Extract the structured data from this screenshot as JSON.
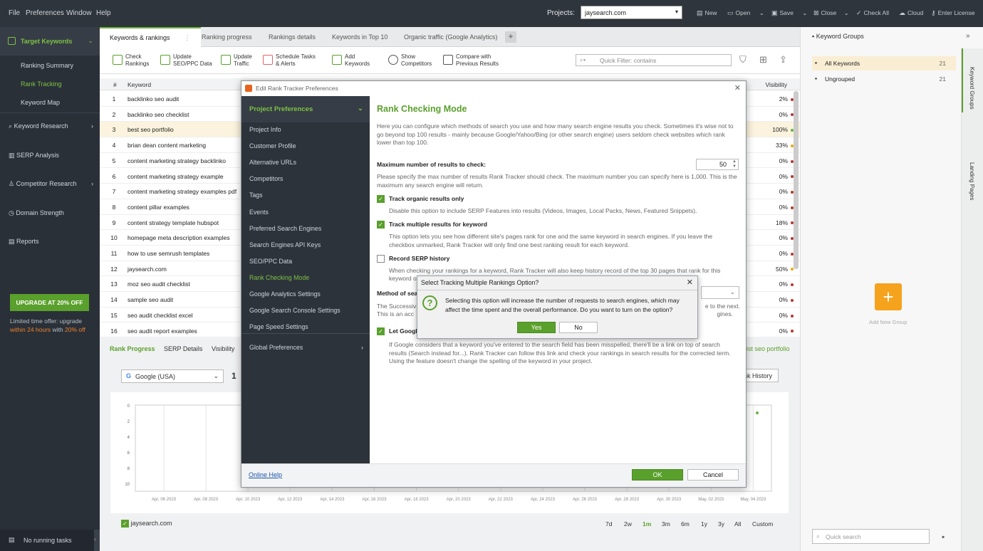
{
  "menu": [
    "File",
    "Preferences",
    "Window",
    "Help"
  ],
  "project": {
    "label": "Projects:",
    "value": "jaysearch.com"
  },
  "toolbar_top": [
    "New",
    "Open",
    "Save",
    "Close",
    "Check All",
    "Cloud",
    "Enter License"
  ],
  "sidebar": {
    "target_keywords": "Target Keywords",
    "sub": [
      "Ranking Summary",
      "Rank Tracking",
      "Keyword Map"
    ],
    "sections": [
      "Keyword Research",
      "SERP Analysis",
      "Competitor Research",
      "Domain Strength",
      "Reports"
    ],
    "upgrade": "UPGRADE AT 20% OFF",
    "offer_1": "Limited time offer: upgrade",
    "offer_2": "within 24 hours",
    "offer_3": "with",
    "offer_4": "20% off",
    "tasks": "No running tasks"
  },
  "tabs": [
    "Keywords & rankings",
    "Ranking progress",
    "Rankings details",
    "Keywords in Top 10",
    "Organic traffic (Google Analytics)"
  ],
  "actions": [
    {
      "l1": "Check",
      "l2": "Rankings"
    },
    {
      "l1": "Update",
      "l2": "SEO/PPC Data"
    },
    {
      "l1": "Update",
      "l2": "Traffic"
    },
    {
      "l1": "Schedule Tasks",
      "l2": "& Alerts"
    },
    {
      "l1": "Add",
      "l2": "Keywords"
    },
    {
      "l1": "Show",
      "l2": "Competitors"
    },
    {
      "l1": "Compare with",
      "l2": "Previous Results"
    }
  ],
  "quick_filter": "Quick Filter: contains",
  "table": {
    "h_num": "#",
    "h_kw": "Keyword",
    "h_vis": "Visibility",
    "rows": [
      {
        "n": "1",
        "k": "backlinko seo audit",
        "v": "2%",
        "c": "r"
      },
      {
        "n": "2",
        "k": "backlinko seo checklist",
        "v": "0%",
        "c": "r"
      },
      {
        "n": "3",
        "k": "best seo portfolio",
        "v": "100%",
        "c": "g"
      },
      {
        "n": "4",
        "k": "brian dean content marketing",
        "v": "33%",
        "c": "y"
      },
      {
        "n": "5",
        "k": "content marketing strategy backlinko",
        "v": "0%",
        "c": "r"
      },
      {
        "n": "6",
        "k": "content marketing strategy example",
        "v": "0%",
        "c": "r"
      },
      {
        "n": "7",
        "k": "content marketing strategy examples pdf",
        "v": "0%",
        "c": "r"
      },
      {
        "n": "8",
        "k": "content pillar examples",
        "v": "0%",
        "c": "r"
      },
      {
        "n": "9",
        "k": "content strategy template hubspot",
        "v": "18%",
        "c": "r"
      },
      {
        "n": "10",
        "k": "homepage meta description examples",
        "v": "0%",
        "c": "r"
      },
      {
        "n": "11",
        "k": "how to use semrush templates",
        "v": "0%",
        "c": "r"
      },
      {
        "n": "12",
        "k": "jaysearch.com",
        "v": "50%",
        "c": "y"
      },
      {
        "n": "13",
        "k": "moz seo audit checklist",
        "v": "0%",
        "c": "r"
      },
      {
        "n": "14",
        "k": "sample seo audit",
        "v": "0%",
        "c": "r"
      },
      {
        "n": "15",
        "k": "seo audit checklist excel",
        "v": "0%",
        "c": "r"
      },
      {
        "n": "16",
        "k": "seo audit report examples",
        "v": "0%",
        "c": "r"
      }
    ]
  },
  "bottom": {
    "tabs": [
      "Rank Progress",
      "SERP Details",
      "Visibility"
    ],
    "engine": "Google (USA)",
    "num": "1",
    "right_link": "est seo portfolio",
    "rank_history": "nk History",
    "y_ticks": [
      "0",
      "2",
      "4",
      "6",
      "8",
      "10"
    ],
    "x_ticks": [
      "Apr, 06 2023",
      "Apr, 08 2023",
      "Apr, 10 2023",
      "Apr, 12 2023",
      "Apr, 14 2023",
      "Apr, 16 2023",
      "Apr, 18 2023",
      "Apr, 20 2023",
      "Apr, 22 2023",
      "Apr, 24 2023",
      "Apr, 26 2023",
      "Apr, 28 2023",
      "Apr, 30 2023",
      "May, 02 2023",
      "May, 04 2023"
    ],
    "legend": "jaysearch.com",
    "ranges": [
      "7d",
      "2w",
      "1m",
      "3m",
      "6m",
      "1y",
      "3y",
      "All",
      "Custom"
    ]
  },
  "right": {
    "title": "Keyword Groups",
    "groups": [
      {
        "name": "All Keywords",
        "count": "21"
      },
      {
        "name": "Ungrouped",
        "count": "21"
      }
    ],
    "add_group": "Add New Group",
    "vtab1": "Keyword Groups",
    "vtab2": "Landing Pages",
    "quick_search": "Quick search"
  },
  "modal": {
    "title": "Edit Rank Tracker Preferences",
    "nav_header": "Project Preferences",
    "nav": [
      "Project Info",
      "Customer Profile",
      "Alternative URLs",
      "Competitors",
      "Tags",
      "Events",
      "Preferred Search Engines",
      "Search Engines API Keys",
      "SEO/PPC Data",
      "Rank Checking Mode",
      "Google Analytics Settings",
      "Google Search Console Settings",
      "Page Speed Settings"
    ],
    "global": "Global Preferences",
    "heading": "Rank Checking Mode",
    "intro": "Here you can configure which methods of search you use and how many search engine results you check. Sometimes it's wise not to go beyond top 100 results - mainly because Google/Yahoo/Bing (or other search engine) users seldom check websites which rank lower than top 100.",
    "max_label": "Maximum number of results to check:",
    "max_value": "50",
    "max_desc": "Please specify the max number of results Rank Tracker should check. The maximum number you can specify here is 1,000. This is the maximum any search engine will return.",
    "opt1": "Track organic results only",
    "opt1_desc": "Disable this option to include SERP Features into results (Videos, Images, Local Packs, News, Featured Snippets).",
    "opt2": "Track multiple results for keyword",
    "opt2_desc": "This option lets you see how different site's pages rank for one and the same keyword in search engines. If you leave the checkbox unmarked, Rank Tracker will only find one best ranking result for each keyword.",
    "opt3": "Record SERP history",
    "opt3_desc": "When checking your rankings for a keyword, Rank Tracker will also keep history record of the top 30 pages that rank for this",
    "opt3_desc_b": "keyword o",
    "method_label": "Method of sea",
    "method_desc_a": "The Successiv",
    "method_desc_a_end": "e to the next.",
    "method_desc_b": "This is an acc",
    "method_desc_b_end": "gines.",
    "opt4": "Let Google",
    "opt4_desc": "If Google considers that a keyword you've entered to the search field has been misspelled, there'll be a link on top of search results (Search instead for...). Rank Tracker can follow this link and check your rankings in search results for the corrected term. Using the feature doesn't change the spelling of the keyword in your project.",
    "help": "Online Help",
    "ok": "OK",
    "cancel": "Cancel"
  },
  "dialog": {
    "title": "Select Tracking Multiple Rankings Option?",
    "message": "Selecting this option will increase the number of requests to search engines, which may affect the time spent and the overall performance. Do you want to turn on the option?",
    "yes": "Yes",
    "no": "No"
  }
}
